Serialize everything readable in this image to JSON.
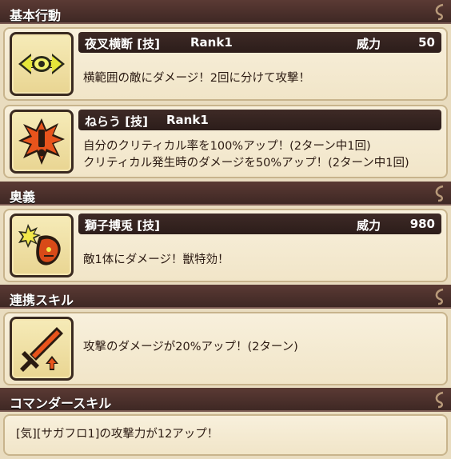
{
  "sections": {
    "basic": "基本行動",
    "ougi": "奥義",
    "renkei": "連携スキル",
    "commander": "コマンダースキル"
  },
  "skills": [
    {
      "name": "夜叉横断 [技]",
      "rank": "Rank1",
      "power_label": "威力",
      "power": "50",
      "desc": [
        "横範囲の敵にダメージ！2回に分けて攻撃！"
      ],
      "icon": "eye-slash-icon"
    },
    {
      "name": "ねらう [技]",
      "rank": "Rank1",
      "desc": [
        "自分のクリティカル率を100%アップ！(2ターン中1回)",
        "クリティカル発生時のダメージを50%アップ！(2ターン中1回)"
      ],
      "icon": "exclamation-burst-icon"
    },
    {
      "name": "獅子搏兎 [技]",
      "power_label": "威力",
      "power": "980",
      "desc": [
        "敵1体にダメージ！獣特効！"
      ],
      "icon": "lion-strike-icon"
    }
  ],
  "renkei": {
    "desc": "攻撃のダメージが20%アップ！(2ターン)",
    "icon": "sword-up-icon"
  },
  "commander": {
    "desc": "[気][サガフロ1]の攻撃力が12アップ！"
  },
  "colors": {
    "header_bg": "#4a302b",
    "card_bg": "#f4e9d0",
    "page_bg": "#e9dcbf"
  }
}
